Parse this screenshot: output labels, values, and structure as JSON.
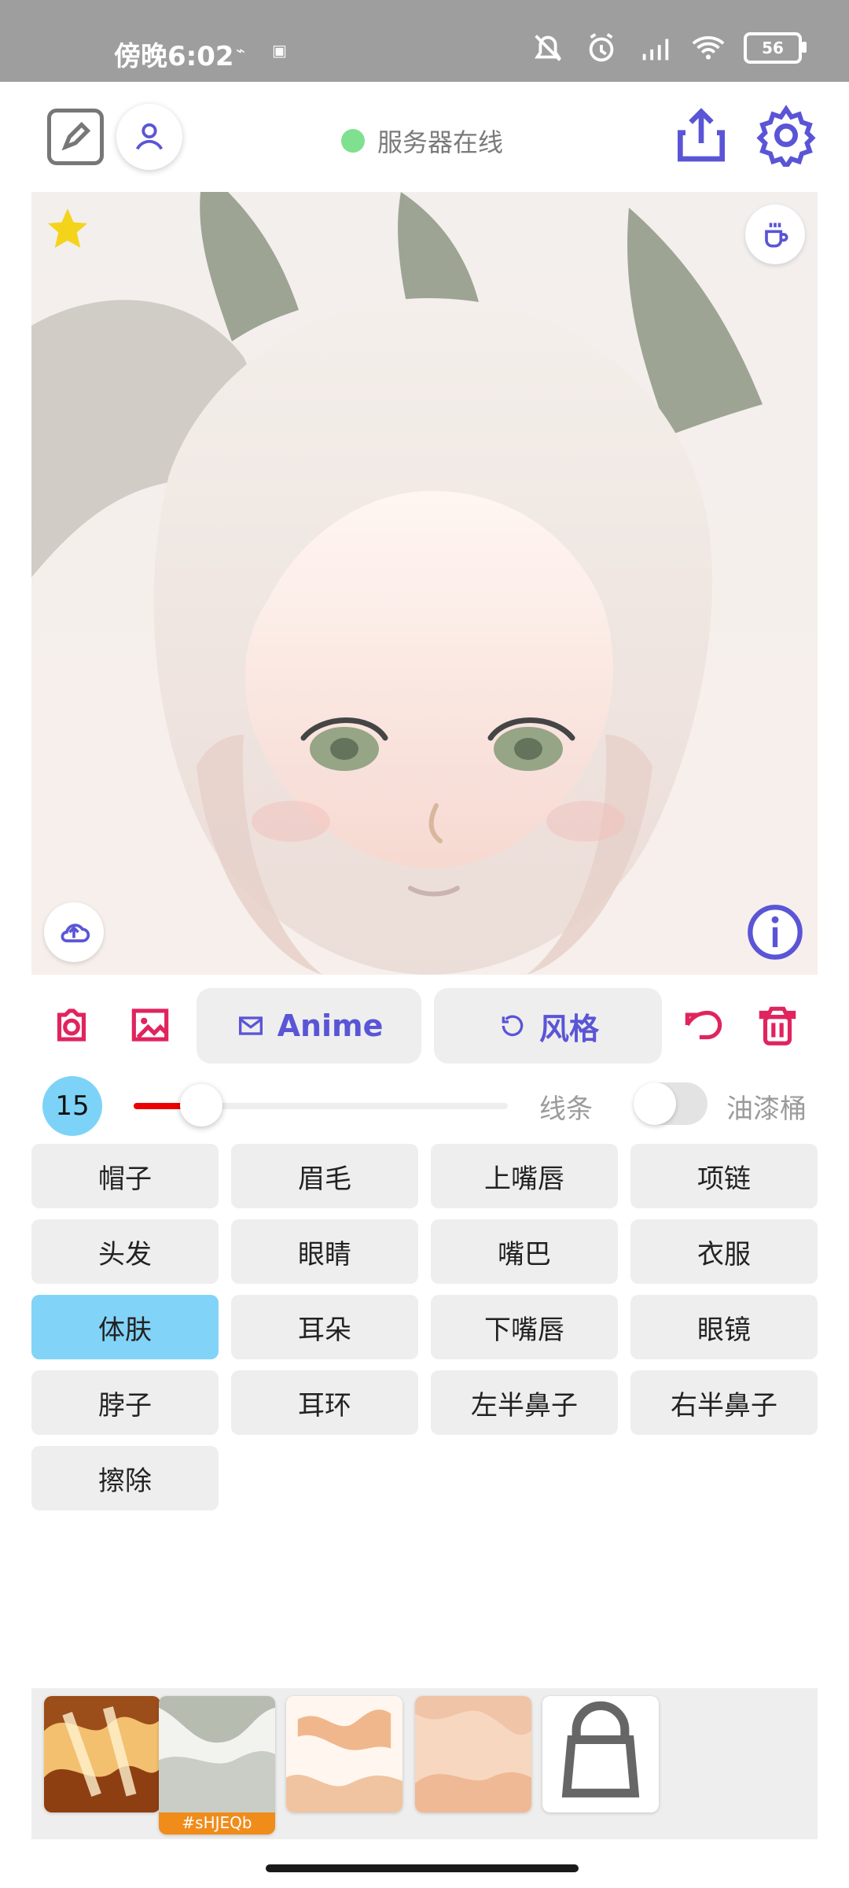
{
  "status_bar": {
    "time": "傍晚6:02",
    "battery": "56"
  },
  "header": {
    "server_status": "服务器在线"
  },
  "tools": {
    "anime_label": "Anime",
    "style_label": "风格"
  },
  "slider": {
    "value": "15",
    "fraction": 0.18,
    "line_label": "线条",
    "bucket_label": "油漆桶"
  },
  "parts": [
    "帽子",
    "眉毛",
    "上嘴唇",
    "项链",
    "头发",
    "眼睛",
    "嘴巴",
    "衣服",
    "体肤",
    "耳朵",
    "下嘴唇",
    "眼镜",
    "脖子",
    "耳环",
    "左半鼻子",
    "右半鼻子",
    "擦除"
  ],
  "active_part": "体肤",
  "palette": {
    "selected_tag": "#sHJEQb"
  },
  "colors": {
    "accent": "#5a55d6",
    "danger": "#e0245e",
    "online": "#7fe08f",
    "active": "#82d3f8",
    "selected": "#f08c1a"
  }
}
